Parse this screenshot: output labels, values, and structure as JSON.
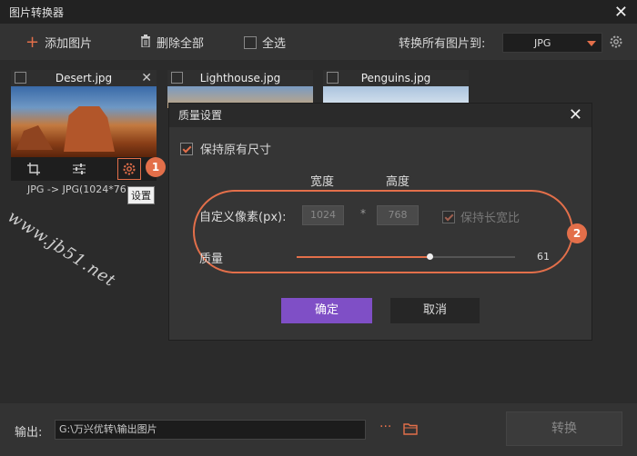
{
  "window": {
    "title": "图片转换器"
  },
  "toolbar": {
    "add_label": "添加图片",
    "delete_all_label": "删除全部",
    "select_all_label": "全选",
    "convert_all_label": "转换所有图片到:",
    "format_value": "JPG"
  },
  "cards": [
    {
      "filename": "Desert.jpg",
      "info": "JPG -> JPG(1024*76",
      "tooltip": "设置"
    },
    {
      "filename": "Lighthouse.jpg"
    },
    {
      "filename": "Penguins.jpg"
    }
  ],
  "badges": {
    "one": "1",
    "two": "2"
  },
  "watermark": "www.jb51.net",
  "dialog": {
    "title": "质量设置",
    "keep_size_label": "保持原有尺寸",
    "width_header": "宽度",
    "height_header": "高度",
    "custom_px_label": "自定义像素(px):",
    "width_value": "1024",
    "times_sign": "*",
    "height_value": "768",
    "keep_ratio_label": "保持长宽比",
    "quality_label": "质量",
    "quality_value": "61",
    "ok_label": "确定",
    "cancel_label": "取消"
  },
  "bottom": {
    "output_label": "输出:",
    "output_path": "G:\\万兴优转\\输出图片",
    "more_label": "···",
    "convert_label": "转换"
  },
  "colors": {
    "accent": "#e36f4a",
    "primary_button": "#7f4fc6"
  }
}
